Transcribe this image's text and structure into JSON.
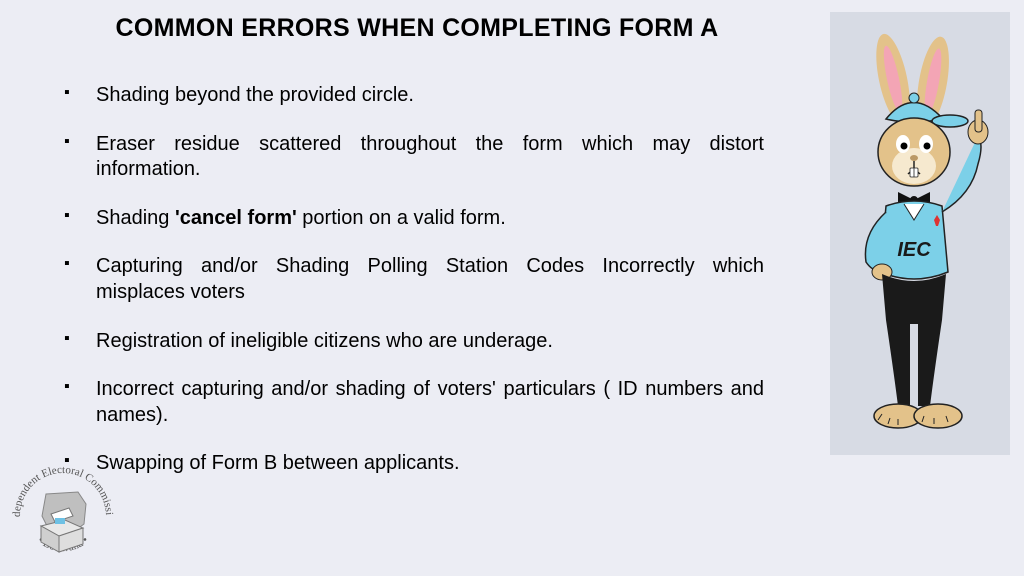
{
  "title": "COMMON ERRORS WHEN COMPLETING FORM A",
  "bullets": [
    {
      "pre": "Shading beyond the provided circle."
    },
    {
      "pre": "Eraser residue scattered throughout the form  which may distort information."
    },
    {
      "pre": "Shading ",
      "bold": "'cancel form'",
      "post": " portion on a valid form."
    },
    {
      "pre": "Capturing and/or Shading Polling Station Codes Incorrectly which misplaces voters"
    },
    {
      "pre": "Registration of ineligible citizens who are underage."
    },
    {
      "pre": "Incorrect capturing and/or shading of voters' particulars ( ID numbers and names)."
    },
    {
      "pre": "Swapping of Form B between applicants."
    }
  ],
  "mascot": {
    "shirt_text": "IEC",
    "colors": {
      "fur": "#e3c28a",
      "cap": "#7cd0e8",
      "shirt": "#7cd0e8",
      "pants": "#1a1a1a",
      "inner_ear": "#f3a5b5"
    }
  },
  "logo": {
    "top_text": "Independent Electoral Commission",
    "bottom_text": "• Botswana •"
  }
}
